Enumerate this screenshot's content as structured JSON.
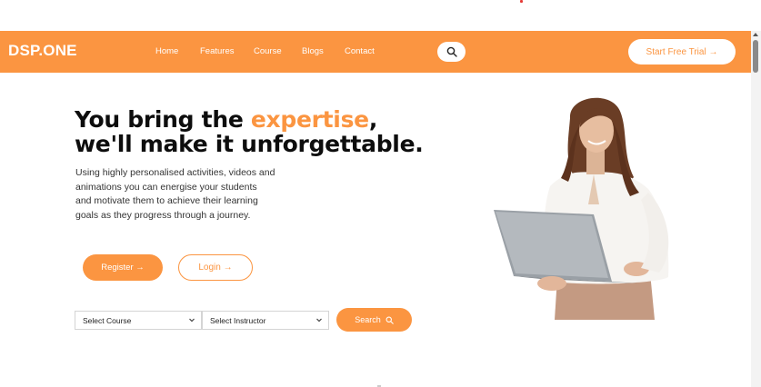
{
  "brand": {
    "logo": "DSP.ONE",
    "accent": "#fb9541"
  },
  "nav": {
    "links": [
      "Home",
      "Features",
      "Course",
      "Blogs",
      "Contact"
    ],
    "search_icon": "search-icon",
    "cta": "Start Free Trial →"
  },
  "hero": {
    "title_line1_prefix": "You bring the ",
    "title_accent": "expertise",
    "title_line1_suffix": ",",
    "title_line2": "we'll make it unforgettable.",
    "description": "Using highly personalised activities, videos and animations you can energise your students and motivate them to achieve their learning goals as they progress through a journey.",
    "register_label": "Register →",
    "login_label": "Login →"
  },
  "search_bar": {
    "course_select": "Select Course",
    "instructor_select": "Select Instructor",
    "search_label": "Search"
  },
  "image": {
    "subject": "woman-holding-laptop"
  }
}
